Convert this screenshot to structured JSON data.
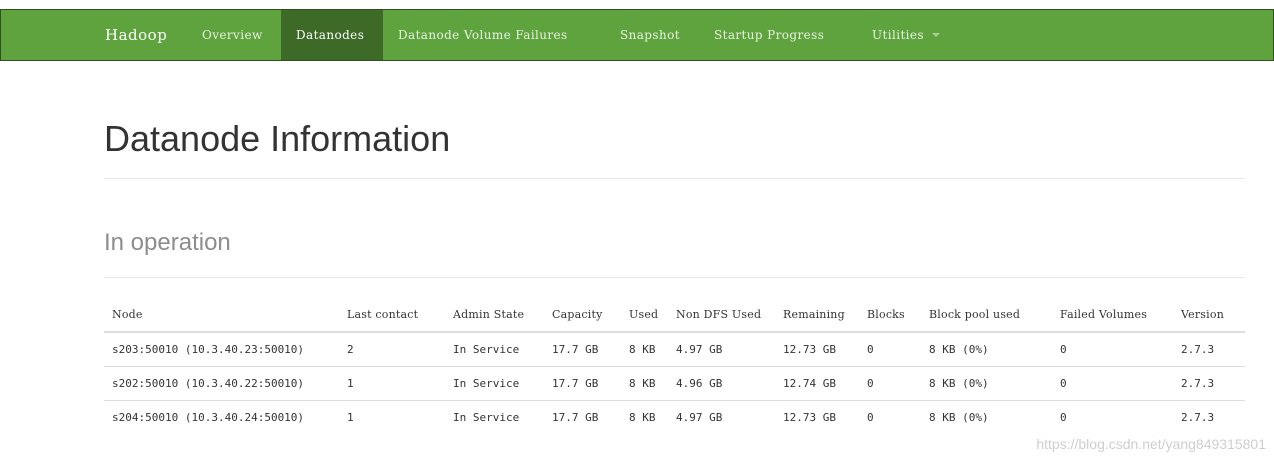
{
  "navbar": {
    "brand": "Hadoop",
    "items": [
      {
        "label": "Overview",
        "active": false
      },
      {
        "label": "Datanodes",
        "active": true
      },
      {
        "label": "Datanode Volume Failures",
        "active": false
      },
      {
        "label": "Snapshot",
        "active": false
      },
      {
        "label": "Startup Progress",
        "active": false
      },
      {
        "label": "Utilities",
        "active": false,
        "dropdown": true
      }
    ],
    "colors": {
      "background": "#5fa33e",
      "active_background": "#3e6a27"
    }
  },
  "page": {
    "title": "Datanode Information",
    "section_title": "In operation"
  },
  "table": {
    "columns": [
      "Node",
      "Last contact",
      "Admin State",
      "Capacity",
      "Used",
      "Non DFS Used",
      "Remaining",
      "Blocks",
      "Block pool used",
      "Failed Volumes",
      "Version"
    ],
    "rows": [
      [
        "s203:50010 (10.3.40.23:50010)",
        "2",
        "In Service",
        "17.7 GB",
        "8 KB",
        "4.97 GB",
        "12.73 GB",
        "0",
        "8 KB (0%)",
        "0",
        "2.7.3"
      ],
      [
        "s202:50010 (10.3.40.22:50010)",
        "1",
        "In Service",
        "17.7 GB",
        "8 KB",
        "4.96 GB",
        "12.74 GB",
        "0",
        "8 KB (0%)",
        "0",
        "2.7.3"
      ],
      [
        "s204:50010 (10.3.40.24:50010)",
        "1",
        "In Service",
        "17.7 GB",
        "8 KB",
        "4.97 GB",
        "12.73 GB",
        "0",
        "8 KB (0%)",
        "0",
        "2.7.3"
      ]
    ]
  },
  "watermark": "https://blog.csdn.net/yang849315801"
}
